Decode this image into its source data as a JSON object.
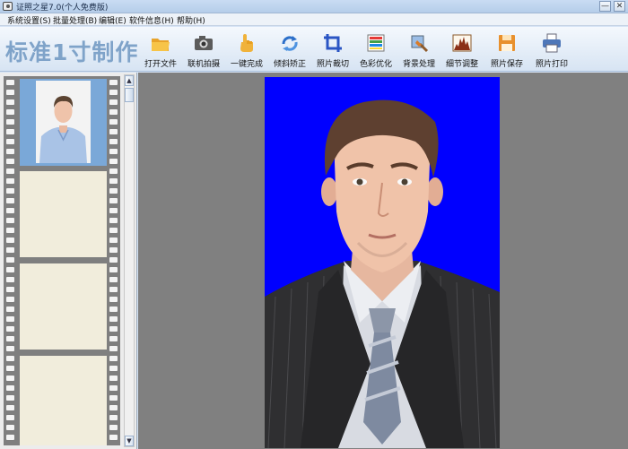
{
  "window": {
    "title": "证照之星7.0(个人免费版)",
    "minimize_glyph": "—",
    "close_glyph": "✕"
  },
  "menu": [
    {
      "label": "系统设置(S)"
    },
    {
      "label": "批量处理(B)"
    },
    {
      "label": "编辑(E)"
    },
    {
      "label": "软件信息(H)"
    },
    {
      "label": "帮助(H)"
    }
  ],
  "toolbar": {
    "brand": "标准1寸制作",
    "tools": [
      {
        "label": "打开文件",
        "icon": "folder-icon"
      },
      {
        "label": "联机拍摄",
        "icon": "camera-icon"
      },
      {
        "label": "一键完成",
        "icon": "hand-pointer-icon"
      },
      {
        "label": "倾斜矫正",
        "icon": "rotate-icon"
      },
      {
        "label": "照片裁切",
        "icon": "crop-icon"
      },
      {
        "label": "色彩优化",
        "icon": "color-bars-icon"
      },
      {
        "label": "背景处理",
        "icon": "brush-icon"
      },
      {
        "label": "细节调整",
        "icon": "histogram-icon"
      },
      {
        "label": "照片保存",
        "icon": "floppy-disk-icon"
      },
      {
        "label": "照片打印",
        "icon": "printer-icon"
      }
    ]
  },
  "film_strip": {
    "frames": [
      {
        "state": "photo"
      },
      {
        "state": "empty"
      },
      {
        "state": "empty"
      },
      {
        "state": "empty"
      }
    ],
    "scroll_up_glyph": "▲",
    "scroll_down_glyph": "▼"
  },
  "photo": {
    "background_color": "#0000ff"
  },
  "colors": {
    "brand_text": "#7fa3c9",
    "photo_background": "#0000ff",
    "canvas": "#808080",
    "film": "#7f7f7f",
    "frame_empty": "#f1eddc",
    "frame_selected": "#7aa8d8"
  }
}
